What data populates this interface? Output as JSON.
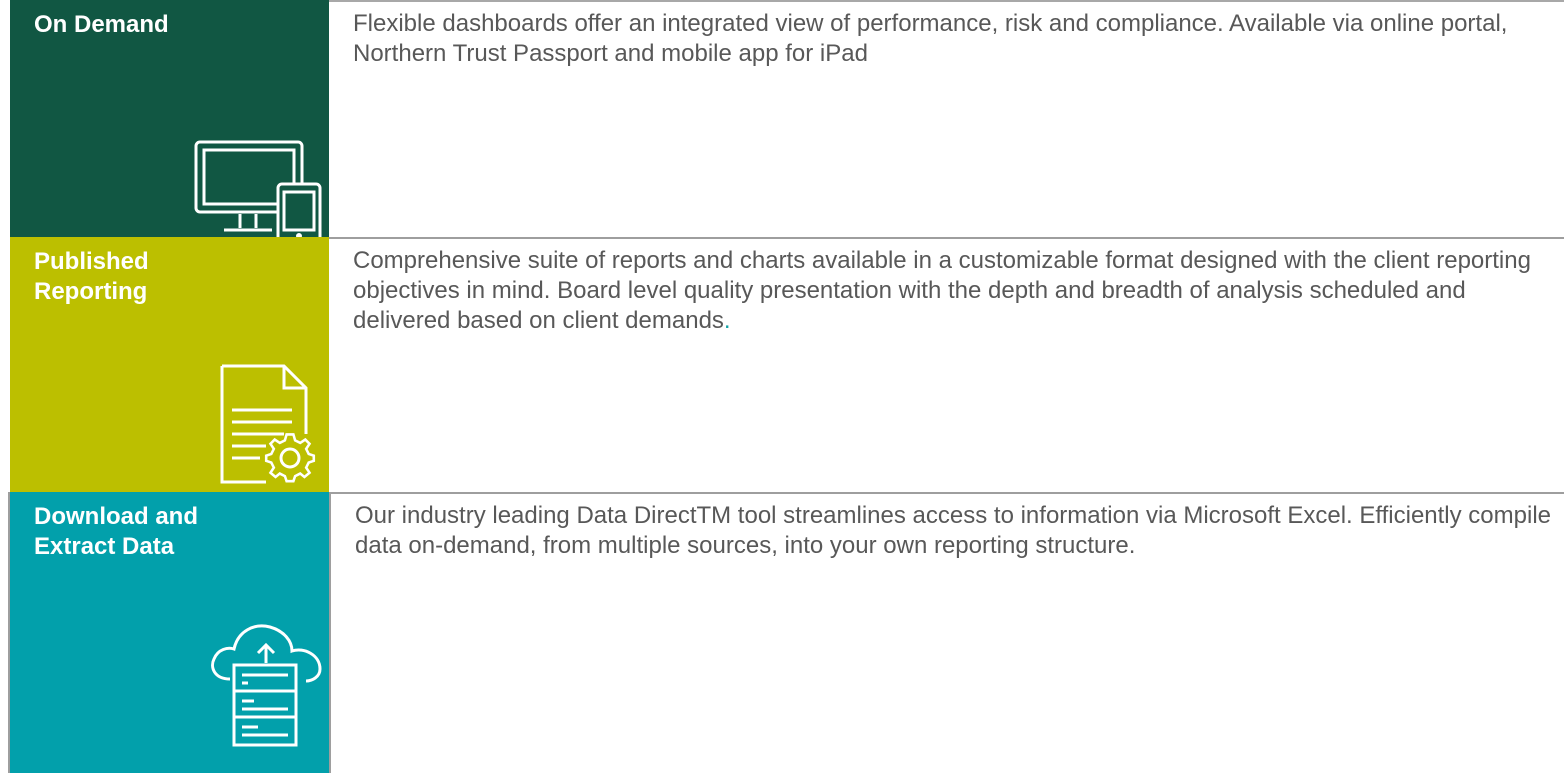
{
  "colors": {
    "on_demand_bg": "#115743",
    "published_bg": "#bcbf00",
    "download_bg": "#02a0ab",
    "text": "#585858",
    "rule": "#9e9e9e"
  },
  "rows": [
    {
      "label": "On Demand",
      "icon": "monitor-tablet-icon",
      "description": "Flexible dashboards offer an integrated view of performance, risk and compliance. Available via online portal, Northern Trust Passport and mobile app for iPad"
    },
    {
      "label": "Published\nReporting",
      "icon": "document-gear-icon",
      "description": "Comprehensive suite of reports and charts available in a customizable format designed with the client reporting objectives in mind.  Board level quality presentation with the depth and breadth of analysis scheduled and delivered based on client demands",
      "description_end": "."
    },
    {
      "label": "Download and\nExtract Data",
      "icon": "cloud-upload-server-icon",
      "description": "Our industry leading Data DirectTM  tool streamlines access to information via Microsoft Excel. Efficiently compile data on-demand, from multiple sources, into your own reporting structure."
    }
  ]
}
